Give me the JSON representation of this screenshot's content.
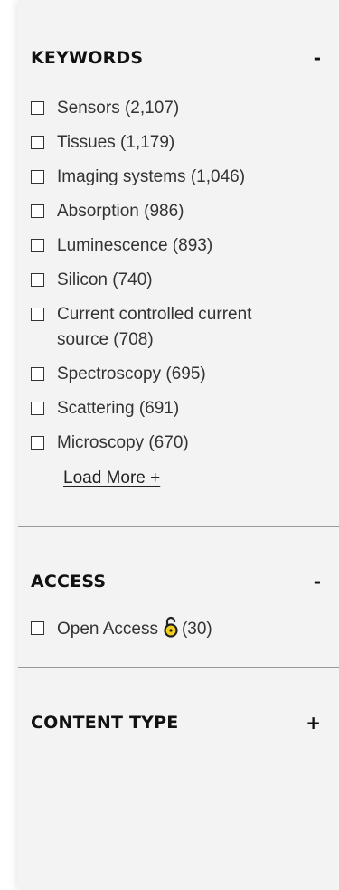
{
  "keywords": {
    "title": "KEYWORDS",
    "toggle": "-",
    "items": [
      {
        "label": "Sensors (2,107)"
      },
      {
        "label": "Tissues (1,179)"
      },
      {
        "label": "Imaging systems (1,046)"
      },
      {
        "label": "Absorption (986)"
      },
      {
        "label": "Luminescence (893)"
      },
      {
        "label": "Silicon (740)"
      },
      {
        "label": "Current controlled current source (708)"
      },
      {
        "label": "Spectroscopy (695)"
      },
      {
        "label": "Scattering (691)"
      },
      {
        "label": "Microscopy (670)"
      }
    ],
    "load_more": "Load More +"
  },
  "access": {
    "title": "ACCESS",
    "toggle": "-",
    "items": [
      {
        "label": "Open Access",
        "count": "(30)",
        "icon": "open-lock-icon",
        "icon_color": "#e8c400"
      }
    ]
  },
  "content_type": {
    "title": "CONTENT TYPE",
    "toggle": "+"
  }
}
